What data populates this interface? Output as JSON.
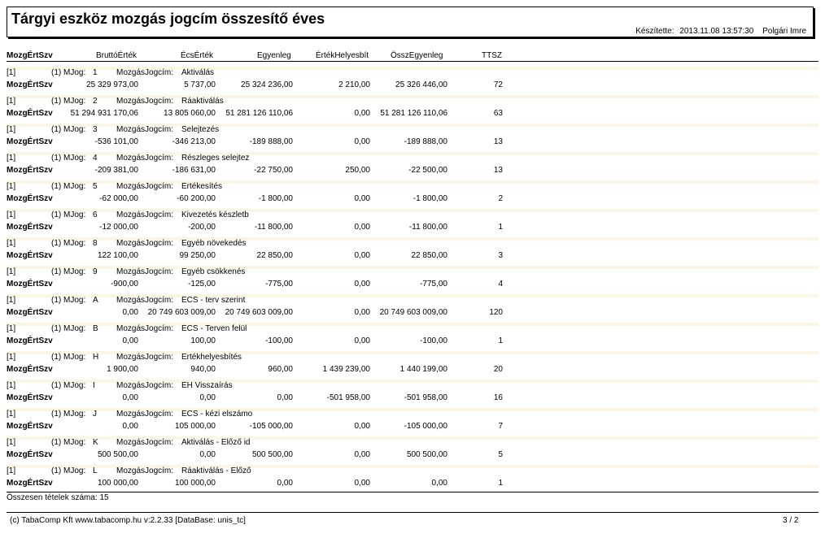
{
  "report": {
    "title": "Tárgyi eszköz mozgás jogcím összesítő éves",
    "made_by_label": "Készítette:",
    "made_at": "2013.11.08 13:57:30",
    "made_by": "Polgári Imre"
  },
  "columns": {
    "c0": "MozgÉrtSzv",
    "c1": "BruttóÉrték",
    "c2": "ÉcsÉrték",
    "c3": "Egyenleg",
    "c4": "ÉrtékHelyesbít",
    "c5": "ÖsszEgyenleg",
    "c6": "TTSZ"
  },
  "labels": {
    "level": "[1]",
    "mjog": "(1) MJog:",
    "mozgas": "MozgásJogcím:",
    "row_label": "MozgÉrtSzv"
  },
  "rows": [
    {
      "code": "1",
      "name": "Aktiválás",
      "brutto": "25 329 973,00",
      "ecs": "5 737,00",
      "egyenleg": "25 324 236,00",
      "helyesbit": "2 210,00",
      "ossz": "25 326 446,00",
      "ttsz": "72"
    },
    {
      "code": "2",
      "name": "Ráaktiválás",
      "brutto": "51 294 931 170,06",
      "ecs": "13 805 060,00",
      "egyenleg": "51 281 126 110,06",
      "helyesbit": "0,00",
      "ossz": "51 281 126 110,06",
      "ttsz": "63"
    },
    {
      "code": "3",
      "name": "Selejtezés",
      "brutto": "-536 101,00",
      "ecs": "-346 213,00",
      "egyenleg": "-189 888,00",
      "helyesbit": "0,00",
      "ossz": "-189 888,00",
      "ttsz": "13"
    },
    {
      "code": "4",
      "name": "Részleges selejtez",
      "brutto": "-209 381,00",
      "ecs": "-186 631,00",
      "egyenleg": "-22 750,00",
      "helyesbit": "250,00",
      "ossz": "-22 500,00",
      "ttsz": "13"
    },
    {
      "code": "5",
      "name": "Értékesítés",
      "brutto": "-62 000,00",
      "ecs": "-60 200,00",
      "egyenleg": "-1 800,00",
      "helyesbit": "0,00",
      "ossz": "-1 800,00",
      "ttsz": "2"
    },
    {
      "code": "6",
      "name": "Kivezetés készletb",
      "brutto": "-12 000,00",
      "ecs": "-200,00",
      "egyenleg": "-11 800,00",
      "helyesbit": "0,00",
      "ossz": "-11 800,00",
      "ttsz": "1"
    },
    {
      "code": "8",
      "name": "Egyéb növekedés",
      "brutto": "122 100,00",
      "ecs": "99 250,00",
      "egyenleg": "22 850,00",
      "helyesbit": "0,00",
      "ossz": "22 850,00",
      "ttsz": "3"
    },
    {
      "code": "9",
      "name": "Egyéb csökkenés",
      "brutto": "-900,00",
      "ecs": "-125,00",
      "egyenleg": "-775,00",
      "helyesbit": "0,00",
      "ossz": "-775,00",
      "ttsz": "4"
    },
    {
      "code": "A",
      "name": "ÉCS - terv szerint",
      "brutto": "0,00",
      "ecs": "20 749 603 009,00",
      "egyenleg": "20 749 603 009,00",
      "helyesbit": "0,00",
      "ossz": "20 749 603 009,00",
      "ttsz": "120"
    },
    {
      "code": "B",
      "name": "ÉCS - Terven felül",
      "brutto": "0,00",
      "ecs": "100,00",
      "egyenleg": "-100,00",
      "helyesbit": "0,00",
      "ossz": "-100,00",
      "ttsz": "1"
    },
    {
      "code": "H",
      "name": "Értékhelyesbítés",
      "brutto": "1 900,00",
      "ecs": "940,00",
      "egyenleg": "960,00",
      "helyesbit": "1 439 239,00",
      "ossz": "1 440 199,00",
      "ttsz": "20"
    },
    {
      "code": "I",
      "name": "ÉH Visszaírás",
      "brutto": "0,00",
      "ecs": "0,00",
      "egyenleg": "0,00",
      "helyesbit": "-501 958,00",
      "ossz": "-501 958,00",
      "ttsz": "16"
    },
    {
      "code": "J",
      "name": "ÉCS - kézi elszámo",
      "brutto": "0,00",
      "ecs": "105 000,00",
      "egyenleg": "-105 000,00",
      "helyesbit": "0,00",
      "ossz": "-105 000,00",
      "ttsz": "7"
    },
    {
      "code": "K",
      "name": "Aktiválás - Előző id",
      "brutto": "500 500,00",
      "ecs": "0,00",
      "egyenleg": "500 500,00",
      "helyesbit": "0,00",
      "ossz": "500 500,00",
      "ttsz": "5"
    },
    {
      "code": "L",
      "name": "Ráaktiválás - Előző",
      "brutto": "100 000,00",
      "ecs": "100 000,00",
      "egyenleg": "0,00",
      "helyesbit": "0,00",
      "ossz": "0,00",
      "ttsz": "1"
    }
  ],
  "summary": {
    "text": "Összesen tételek száma: 15"
  },
  "footer": {
    "copyright": "(c) TabaComp Kft  www.tabacomp.hu  v:2.2.33 [DataBase: unis_tc]",
    "page": "3  / 2"
  }
}
